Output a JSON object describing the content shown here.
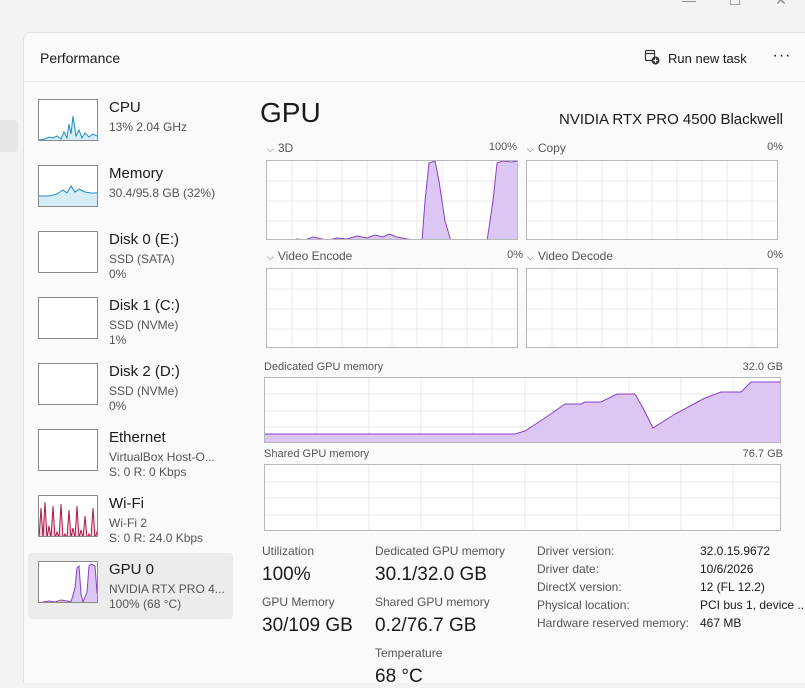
{
  "window": {
    "minimize_glyph": "—",
    "maximize_glyph": "☐",
    "close_glyph": "✕"
  },
  "header": {
    "title": "Performance",
    "run_task_label": "Run new task",
    "more_glyph": "···"
  },
  "sidebar": {
    "items": [
      {
        "name": "CPU",
        "sub1": "13%  2.04 GHz",
        "sub2": ""
      },
      {
        "name": "Memory",
        "sub1": "30.4/95.8 GB (32%)",
        "sub2": ""
      },
      {
        "name": "Disk 0 (E:)",
        "sub1": "SSD (SATA)",
        "sub2": "0%"
      },
      {
        "name": "Disk 1 (C:)",
        "sub1": "SSD (NVMe)",
        "sub2": "1%"
      },
      {
        "name": "Disk 2 (D:)",
        "sub1": "SSD (NVMe)",
        "sub2": "0%"
      },
      {
        "name": "Ethernet",
        "sub1": "VirtualBox Host-O...",
        "sub2": "S: 0  R: 0 Kbps"
      },
      {
        "name": "Wi-Fi",
        "sub1": "Wi-Fi 2",
        "sub2": "S: 0  R: 24.0 Kbps"
      },
      {
        "name": "GPU 0",
        "sub1": "NVIDIA RTX PRO 4...",
        "sub2": "100%  (68 °C)"
      }
    ]
  },
  "main": {
    "title": "GPU",
    "model": "NVIDIA RTX PRO 4500 Blackwell",
    "engines": [
      {
        "label": "3D",
        "pct": "100%"
      },
      {
        "label": "Copy",
        "pct": "0%"
      },
      {
        "label": "Video Encode",
        "pct": "0%"
      },
      {
        "label": "Video Decode",
        "pct": "0%"
      }
    ],
    "dedicated_label": "Dedicated GPU memory",
    "dedicated_max": "32.0 GB",
    "shared_label": "Shared GPU memory",
    "shared_max": "76.7 GB"
  },
  "stats": {
    "utilization_label": "Utilization",
    "utilization_value": "100%",
    "gpu_memory_label": "GPU Memory",
    "gpu_memory_value": "30/109 GB",
    "dedicated_label": "Dedicated GPU memory",
    "dedicated_value": "30.1/32.0 GB",
    "shared_label": "Shared GPU memory",
    "shared_value": "0.2/76.7 GB",
    "temperature_label": "Temperature",
    "temperature_value": "68 °C"
  },
  "info": [
    {
      "key": "Driver version:",
      "value": "32.0.15.9672"
    },
    {
      "key": "Driver date:",
      "value": "10/6/2026"
    },
    {
      "key": "DirectX version:",
      "value": "12 (FL 12.2)"
    },
    {
      "key": "Physical location:",
      "value": "PCI bus 1, device ..."
    },
    {
      "key": "Hardware reserved memory:",
      "value": "467 MB"
    }
  ],
  "colors": {
    "gpu_line": "#8b3fc7",
    "gpu_fill": "#dcc6f3",
    "cpu_line": "#1b8fc9",
    "cpu_fill": "#d6ecf7",
    "wifi_line": "#b1174a",
    "wifi_fill": "#f2d1dd",
    "grid": "#e9e9e9"
  },
  "icons": {
    "run_task": "run-task-icon",
    "more": "more-options-icon"
  }
}
